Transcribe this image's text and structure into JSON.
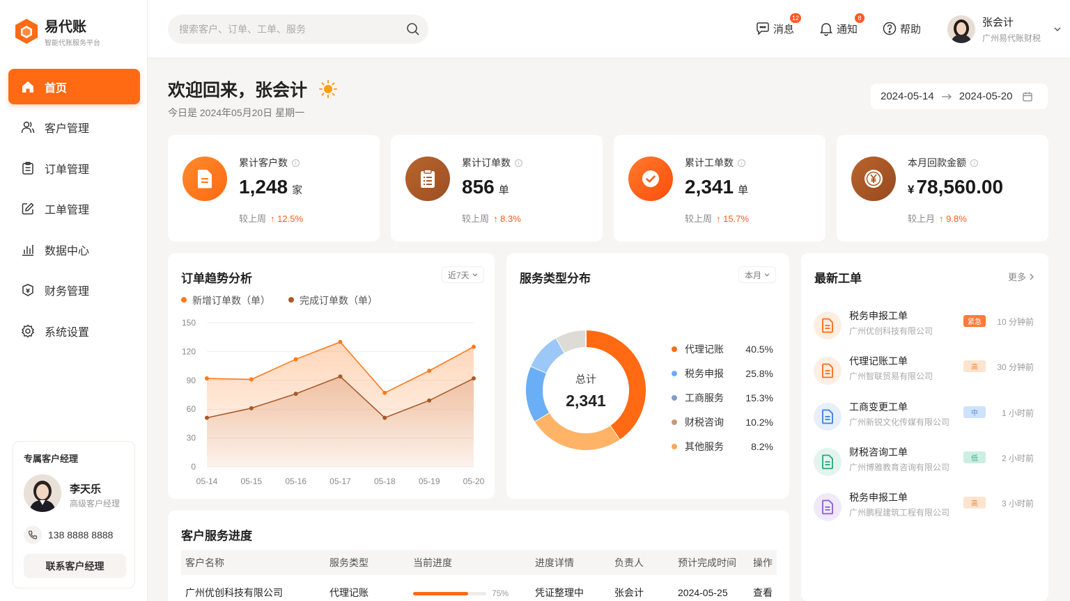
{
  "brand": {
    "title": "易代账",
    "subtitle": "智能代账服务平台"
  },
  "nav": [
    {
      "label": "首页",
      "icon": "home-icon",
      "active": true
    },
    {
      "label": "客户管理",
      "icon": "users-icon"
    },
    {
      "label": "订单管理",
      "icon": "clipboard-icon"
    },
    {
      "label": "工单管理",
      "icon": "edit-icon"
    },
    {
      "label": "数据中心",
      "icon": "bar-chart-icon"
    },
    {
      "label": "财务管理",
      "icon": "finance-icon"
    },
    {
      "label": "系统设置",
      "icon": "gear-icon"
    }
  ],
  "manager": {
    "title": "专属客户经理",
    "name": "李天乐",
    "role": "高级客户经理",
    "phone": "138 8888 8888",
    "button": "联系客户经理"
  },
  "header": {
    "search_placeholder": "搜索客户、订单、工单、服务",
    "messages": {
      "label": "消息",
      "count": "12"
    },
    "notifications": {
      "label": "通知",
      "count": "8"
    },
    "help": "帮助",
    "user": {
      "name": "张会计",
      "org": "广州易代账财税"
    }
  },
  "welcome": {
    "title": "欢迎回来，张会计",
    "date": "今日是 2024年05月20日 星期一"
  },
  "date_range": {
    "start": "2024-05-14",
    "end": "2024-05-20"
  },
  "stats": [
    {
      "label": "累计客户数",
      "value": "1,248",
      "unit": "家",
      "compare": "较上周",
      "change": "12.5%",
      "color": "#ff7a1a"
    },
    {
      "label": "累计订单数",
      "value": "856",
      "unit": "单",
      "compare": "较上周",
      "change": "8.3%",
      "color": "#a9582a"
    },
    {
      "label": "累计工单数",
      "value": "2,341",
      "unit": "单",
      "compare": "较上周",
      "change": "15.7%",
      "color": "#ff5a14"
    },
    {
      "label": "本月回款金额",
      "value": "78,560.00",
      "currency": "¥",
      "unit": "",
      "compare": "较上月",
      "change": "9.8%",
      "color": "#a85a27"
    }
  ],
  "trend": {
    "title": "订单趋势分析",
    "range": "近7天",
    "chart_data": {
      "type": "area",
      "x": [
        "05-14",
        "05-15",
        "05-16",
        "05-17",
        "05-18",
        "05-19",
        "05-20"
      ],
      "ylim": [
        0,
        150
      ],
      "yticks": [
        0,
        30,
        60,
        90,
        120,
        150
      ],
      "series": [
        {
          "name": "新增订单数（单）",
          "color": "#ff7a1a",
          "values": [
            92,
            91,
            112,
            130,
            77,
            100,
            125
          ]
        },
        {
          "name": "完成订单数（单）",
          "color": "#a85a27",
          "values": [
            51,
            61,
            76,
            94,
            51,
            69,
            92
          ]
        }
      ]
    }
  },
  "services": {
    "title": "服务类型分布",
    "range": "本月",
    "total_label": "总计",
    "total": "2,341",
    "chart_data": {
      "type": "pie",
      "labels": [
        "代理记账",
        "税务申报",
        "工商服务",
        "财税咨询",
        "其他服务"
      ],
      "values": [
        40.5,
        25.8,
        15.3,
        10.2,
        8.2
      ],
      "display": [
        "40.5%",
        "25.8%",
        "15.3%",
        "10.2%",
        "8.2%"
      ]
    },
    "ring_colors": [
      "#ff6a13",
      "#ffb366",
      "#6aaef5",
      "#9cc8f7",
      "#dedad6"
    ],
    "legend_colors": [
      "#ff6a13",
      "#6aaef5",
      "#7f9ec9",
      "#c49a7c",
      "#ffa55a"
    ]
  },
  "tickets": {
    "title": "最新工单",
    "more": "更多",
    "items": [
      {
        "title": "税务申报工单",
        "company": "广州优创科技有限公司",
        "tag": "紧急",
        "time": "10 分钟前",
        "icon_bg": "#fdeee3",
        "icon_color": "#ff6a13",
        "tag_bg": "#ff7a3a",
        "tag_fg": "#ffffff"
      },
      {
        "title": "代理记账工单",
        "company": "广州智联贸易有限公司",
        "tag": "高",
        "time": "30 分钟前",
        "icon_bg": "#fdeee3",
        "icon_color": "#ff6a13",
        "tag_bg": "#fde4cf",
        "tag_fg": "#f08a3a"
      },
      {
        "title": "工商变更工单",
        "company": "广州新锐文化传媒有限公司",
        "tag": "中",
        "time": "1 小时前",
        "icon_bg": "#e6effb",
        "icon_color": "#3d7be6",
        "tag_bg": "#cfe2fb",
        "tag_fg": "#5a8fdc"
      },
      {
        "title": "财税咨询工单",
        "company": "广州博雅教育咨询有限公司",
        "tag": "低",
        "time": "2 小时前",
        "icon_bg": "#e3f4ee",
        "icon_color": "#27a37a",
        "tag_bg": "#cdeee3",
        "tag_fg": "#3fae88"
      },
      {
        "title": "税务申报工单",
        "company": "广州鹏程建筑工程有限公司",
        "tag": "高",
        "time": "3 小时前",
        "icon_bg": "#efe9f8",
        "icon_color": "#8a5cd0",
        "tag_bg": "#fde4cf",
        "tag_fg": "#f08a3a"
      }
    ]
  },
  "progress": {
    "title": "客户服务进度",
    "columns": [
      "客户名称",
      "服务类型",
      "当前进度",
      "进度详情",
      "负责人",
      "预计完成时间",
      "操作"
    ],
    "rows": [
      {
        "customer": "广州优创科技有限公司",
        "service": "代理记账",
        "progress": 75,
        "progress_label": "75%",
        "detail": "凭证整理中",
        "owner": "张会计",
        "due": "2024-05-25",
        "action": "查看"
      }
    ]
  }
}
